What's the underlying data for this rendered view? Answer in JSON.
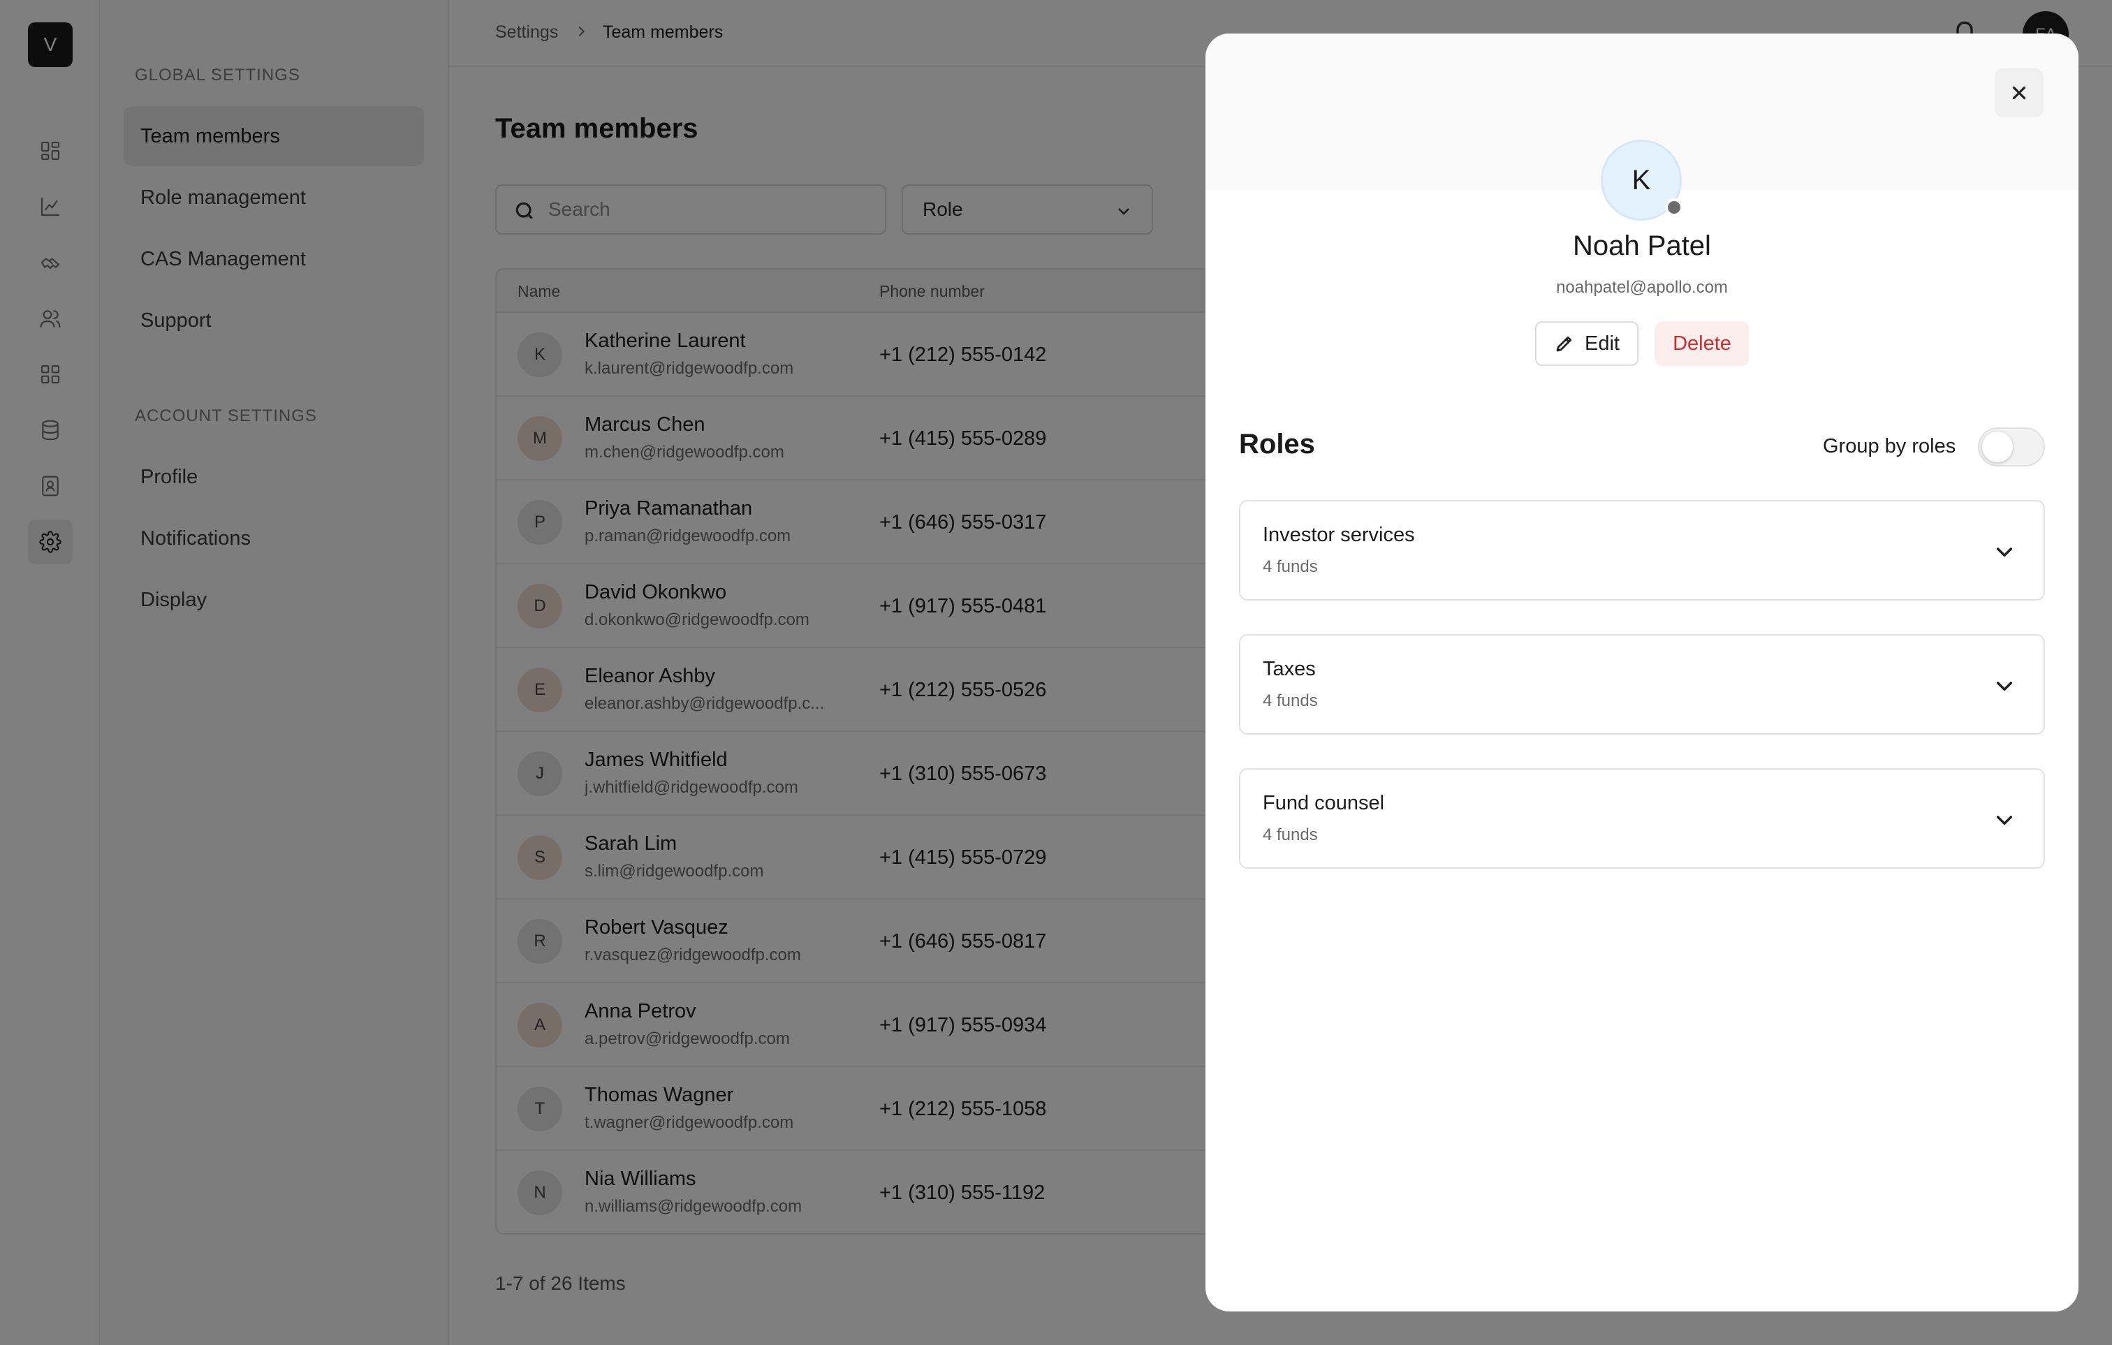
{
  "rail": {
    "logo": "V",
    "items": [
      {
        "icon": "dashboard-icon"
      },
      {
        "icon": "chart-icon"
      },
      {
        "icon": "handshake-icon"
      },
      {
        "icon": "users-icon"
      },
      {
        "icon": "grid-icon"
      },
      {
        "icon": "database-icon"
      },
      {
        "icon": "contacts-icon"
      },
      {
        "icon": "gear-icon",
        "active": true
      }
    ]
  },
  "sidebar": {
    "global_label": "GLOBAL SETTINGS",
    "global_items": [
      {
        "label": "Team members",
        "active": true
      },
      {
        "label": "Role management"
      },
      {
        "label": "CAS Management"
      },
      {
        "label": "Support"
      }
    ],
    "account_label": "ACCOUNT SETTINGS",
    "account_items": [
      {
        "label": "Profile"
      },
      {
        "label": "Notifications"
      },
      {
        "label": "Display"
      }
    ]
  },
  "header": {
    "breadcrumb": [
      "Settings",
      "Team members"
    ],
    "user_initials": "EA"
  },
  "main": {
    "title": "Team members",
    "search_placeholder": "Search",
    "role_filter": "Role",
    "columns": [
      "Name",
      "Phone number"
    ],
    "rows": [
      {
        "initial": "K",
        "name": "Katherine Laurent",
        "email": "k.laurent@ridgewoodfp.com",
        "phone": "+1 (212) 555-0142",
        "avatar_color": "#e4e4e4"
      },
      {
        "initial": "M",
        "name": "Marcus Chen",
        "email": "m.chen@ridgewoodfp.com",
        "phone": "+1 (415) 555-0289",
        "avatar_color": "#f1ddd0"
      },
      {
        "initial": "P",
        "name": "Priya Ramanathan",
        "email": "p.raman@ridgewoodfp.com",
        "phone": "+1 (646) 555-0317",
        "avatar_color": "#e4e4e4"
      },
      {
        "initial": "D",
        "name": "David Okonkwo",
        "email": "d.okonkwo@ridgewoodfp.com",
        "phone": "+1 (917) 555-0481",
        "avatar_color": "#f1ddd0"
      },
      {
        "initial": "E",
        "name": "Eleanor Ashby",
        "email": "eleanor.ashby@ridgewoodfp.c...",
        "phone": "+1 (212) 555-0526",
        "avatar_color": "#f1ddd0"
      },
      {
        "initial": "J",
        "name": "James Whitfield",
        "email": "j.whitfield@ridgewoodfp.com",
        "phone": "+1 (310) 555-0673",
        "avatar_color": "#e4e4e4"
      },
      {
        "initial": "S",
        "name": "Sarah Lim",
        "email": "s.lim@ridgewoodfp.com",
        "phone": "+1 (415) 555-0729",
        "avatar_color": "#f1ddd0"
      },
      {
        "initial": "R",
        "name": "Robert Vasquez",
        "email": "r.vasquez@ridgewoodfp.com",
        "phone": "+1 (646) 555-0817",
        "avatar_color": "#e4e4e4"
      },
      {
        "initial": "A",
        "name": "Anna Petrov",
        "email": "a.petrov@ridgewoodfp.com",
        "phone": "+1 (917) 555-0934",
        "avatar_color": "#f1ddd0"
      },
      {
        "initial": "T",
        "name": "Thomas Wagner",
        "email": "t.wagner@ridgewoodfp.com",
        "phone": "+1 (212) 555-1058",
        "avatar_color": "#e4e4e4"
      },
      {
        "initial": "N",
        "name": "Nia Williams",
        "email": "n.williams@ridgewoodfp.com",
        "phone": "+1 (310) 555-1192",
        "avatar_color": "#e4e4e4"
      }
    ],
    "pagination": "1-7 of 26 Items"
  },
  "drawer": {
    "initial": "K",
    "name": "Noah Patel",
    "email": "noahpatel@apollo.com",
    "edit_label": "Edit",
    "delete_label": "Delete",
    "roles_title": "Roles",
    "group_by_label": "Group by roles",
    "group_by_enabled": false,
    "roles": [
      {
        "name": "Investor services",
        "sub": "4 funds"
      },
      {
        "name": "Taxes",
        "sub": "4 funds"
      },
      {
        "name": "Fund counsel",
        "sub": "4 funds"
      }
    ]
  },
  "colors": {
    "delete_text": "#d12b2b",
    "delete_bg": "#fdeeee",
    "avatar_bg": "#e3f2fd",
    "overlay": "rgba(0,0,0,0.5)"
  }
}
